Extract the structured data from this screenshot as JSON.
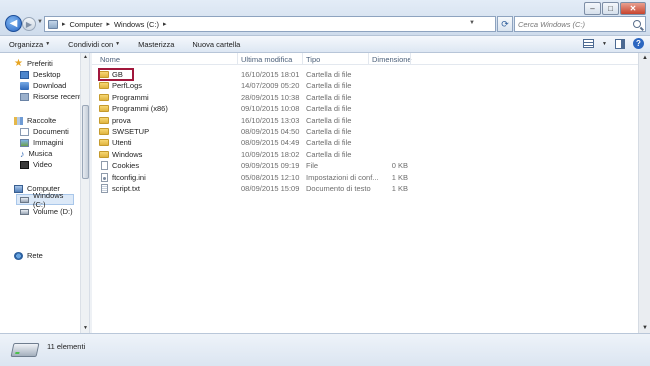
{
  "address": {
    "crumbs": [
      "Computer",
      "Windows (C:)"
    ]
  },
  "search": {
    "placeholder": "Cerca Windows (C:)"
  },
  "toolbar": {
    "organize_label": "Organizza",
    "share_label": "Condividi con",
    "burn_label": "Masterizza",
    "new_folder_label": "Nuova cartella"
  },
  "nav": {
    "favorites_label": "Preferiti",
    "favorites": [
      "Desktop",
      "Download",
      "Risorse recenti"
    ],
    "libraries_label": "Raccolte",
    "libraries": [
      "Documenti",
      "Immagini",
      "Musica",
      "Video"
    ],
    "computer_label": "Computer",
    "drives": [
      "Windows (C:)",
      "Volume (D:)"
    ],
    "network_label": "Rete"
  },
  "columns": {
    "name": "Nome",
    "modified": "Ultima modifica",
    "type": "Tipo",
    "size": "Dimensione"
  },
  "files": [
    {
      "name": "GB",
      "modified": "16/10/2015 18:01",
      "type": "Cartella di file",
      "size": "",
      "kind": "folder"
    },
    {
      "name": "PerfLogs",
      "modified": "14/07/2009 05:20",
      "type": "Cartella di file",
      "size": "",
      "kind": "folder"
    },
    {
      "name": "Programmi",
      "modified": "28/09/2015 10:38",
      "type": "Cartella di file",
      "size": "",
      "kind": "folder"
    },
    {
      "name": "Programmi (x86)",
      "modified": "09/10/2015 10:08",
      "type": "Cartella di file",
      "size": "",
      "kind": "folder"
    },
    {
      "name": "prova",
      "modified": "16/10/2015 13:03",
      "type": "Cartella di file",
      "size": "",
      "kind": "folder"
    },
    {
      "name": "SWSETUP",
      "modified": "08/09/2015 04:50",
      "type": "Cartella di file",
      "size": "",
      "kind": "folder"
    },
    {
      "name": "Utenti",
      "modified": "08/09/2015 04:49",
      "type": "Cartella di file",
      "size": "",
      "kind": "folder"
    },
    {
      "name": "Windows",
      "modified": "10/09/2015 18:02",
      "type": "Cartella di file",
      "size": "",
      "kind": "folder"
    },
    {
      "name": "Cookies",
      "modified": "09/09/2015 09:19",
      "type": "File",
      "size": "0 KB",
      "kind": "file"
    },
    {
      "name": "ftconfig.ini",
      "modified": "05/08/2015 12:10",
      "type": "Impostazioni di conf...",
      "size": "1 KB",
      "kind": "cfg"
    },
    {
      "name": "script.txt",
      "modified": "08/09/2015 15:09",
      "type": "Documento di testo",
      "size": "1 KB",
      "kind": "txt"
    }
  ],
  "status": {
    "count_label": "11 elementi"
  }
}
